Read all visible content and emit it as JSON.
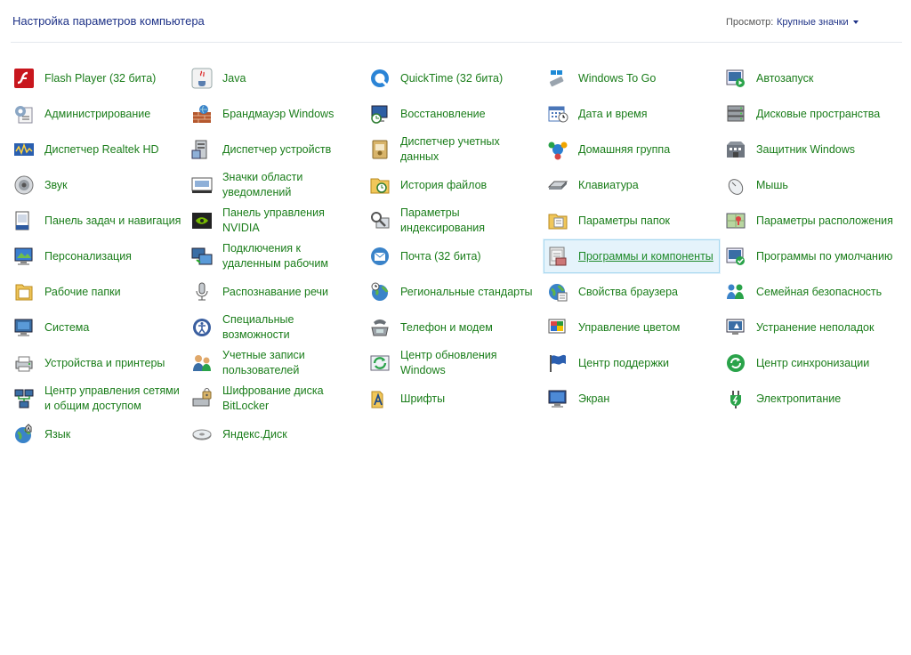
{
  "header": {
    "title": "Настройка параметров компьютера",
    "view_label": "Просмотр:",
    "view_value": "Крупные значки"
  },
  "selected_item": "Программы и компоненты",
  "items": [
    {
      "label": "Flash Player (32 бита)",
      "icon": "flash-icon"
    },
    {
      "label": "Java",
      "icon": "java-icon"
    },
    {
      "label": "QuickTime (32 бита)",
      "icon": "quicktime-icon"
    },
    {
      "label": "Windows To Go",
      "icon": "usb-drive-icon"
    },
    {
      "label": "Автозапуск",
      "icon": "autoplay-icon"
    },
    {
      "label": "Администрирование",
      "icon": "admin-tools-icon"
    },
    {
      "label": "Брандмауэр Windows",
      "icon": "firewall-icon"
    },
    {
      "label": "Восстановление",
      "icon": "recovery-icon"
    },
    {
      "label": "Дата и время",
      "icon": "calendar-clock-icon"
    },
    {
      "label": "Дисковые пространства",
      "icon": "storage-spaces-icon"
    },
    {
      "label": "Диспетчер Realtek HD",
      "icon": "realtek-audio-icon"
    },
    {
      "label": "Диспетчер устройств",
      "icon": "device-manager-icon"
    },
    {
      "label": "Диспетчер учетных данных",
      "icon": "credential-manager-icon"
    },
    {
      "label": "Домашняя группа",
      "icon": "homegroup-icon"
    },
    {
      "label": "Защитник Windows",
      "icon": "defender-icon"
    },
    {
      "label": "Звук",
      "icon": "speaker-icon"
    },
    {
      "label": "Значки области уведомлений",
      "icon": "notification-area-icon"
    },
    {
      "label": "История файлов",
      "icon": "file-history-icon"
    },
    {
      "label": "Клавиатура",
      "icon": "keyboard-icon"
    },
    {
      "label": "Мышь",
      "icon": "mouse-icon"
    },
    {
      "label": "Панель задач и навигация",
      "icon": "taskbar-icon"
    },
    {
      "label": "Панель управления NVIDIA",
      "icon": "nvidia-icon"
    },
    {
      "label": "Параметры индексирования",
      "icon": "indexing-icon"
    },
    {
      "label": "Параметры папок",
      "icon": "folder-options-icon"
    },
    {
      "label": "Параметры расположения",
      "icon": "location-icon"
    },
    {
      "label": "Персонализация",
      "icon": "personalization-icon"
    },
    {
      "label": "Подключения к удаленным рабочим",
      "icon": "remote-desktop-icon"
    },
    {
      "label": "Почта (32 бита)",
      "icon": "mail-icon"
    },
    {
      "label": "Программы и компоненты",
      "icon": "programs-features-icon"
    },
    {
      "label": "Программы по умолчанию",
      "icon": "default-programs-icon"
    },
    {
      "label": "Рабочие папки",
      "icon": "work-folders-icon"
    },
    {
      "label": "Распознавание речи",
      "icon": "microphone-icon"
    },
    {
      "label": "Региональные стандарты",
      "icon": "region-icon"
    },
    {
      "label": "Свойства браузера",
      "icon": "internet-options-icon"
    },
    {
      "label": "Семейная безопасность",
      "icon": "family-safety-icon"
    },
    {
      "label": "Система",
      "icon": "system-icon"
    },
    {
      "label": "Специальные возможности",
      "icon": "accessibility-icon"
    },
    {
      "label": "Телефон и модем",
      "icon": "phone-modem-icon"
    },
    {
      "label": "Управление цветом",
      "icon": "color-management-icon"
    },
    {
      "label": "Устранение неполадок",
      "icon": "troubleshooting-icon"
    },
    {
      "label": "Устройства и принтеры",
      "icon": "devices-printers-icon"
    },
    {
      "label": "Учетные записи пользователей",
      "icon": "user-accounts-icon"
    },
    {
      "label": "Центр обновления Windows",
      "icon": "windows-update-icon"
    },
    {
      "label": "Центр поддержки",
      "icon": "action-center-flag-icon"
    },
    {
      "label": "Центр синхронизации",
      "icon": "sync-center-icon"
    },
    {
      "label": "Центр управления сетями и общим доступом",
      "icon": "network-center-icon"
    },
    {
      "label": "Шифрование диска BitLocker",
      "icon": "bitlocker-icon"
    },
    {
      "label": "Шрифты",
      "icon": "fonts-icon"
    },
    {
      "label": "Экран",
      "icon": "display-icon"
    },
    {
      "label": "Электропитание",
      "icon": "power-options-icon"
    },
    {
      "label": "Язык",
      "icon": "language-icon"
    },
    {
      "label": "Яндекс.Диск",
      "icon": "yandex-disk-icon"
    }
  ]
}
